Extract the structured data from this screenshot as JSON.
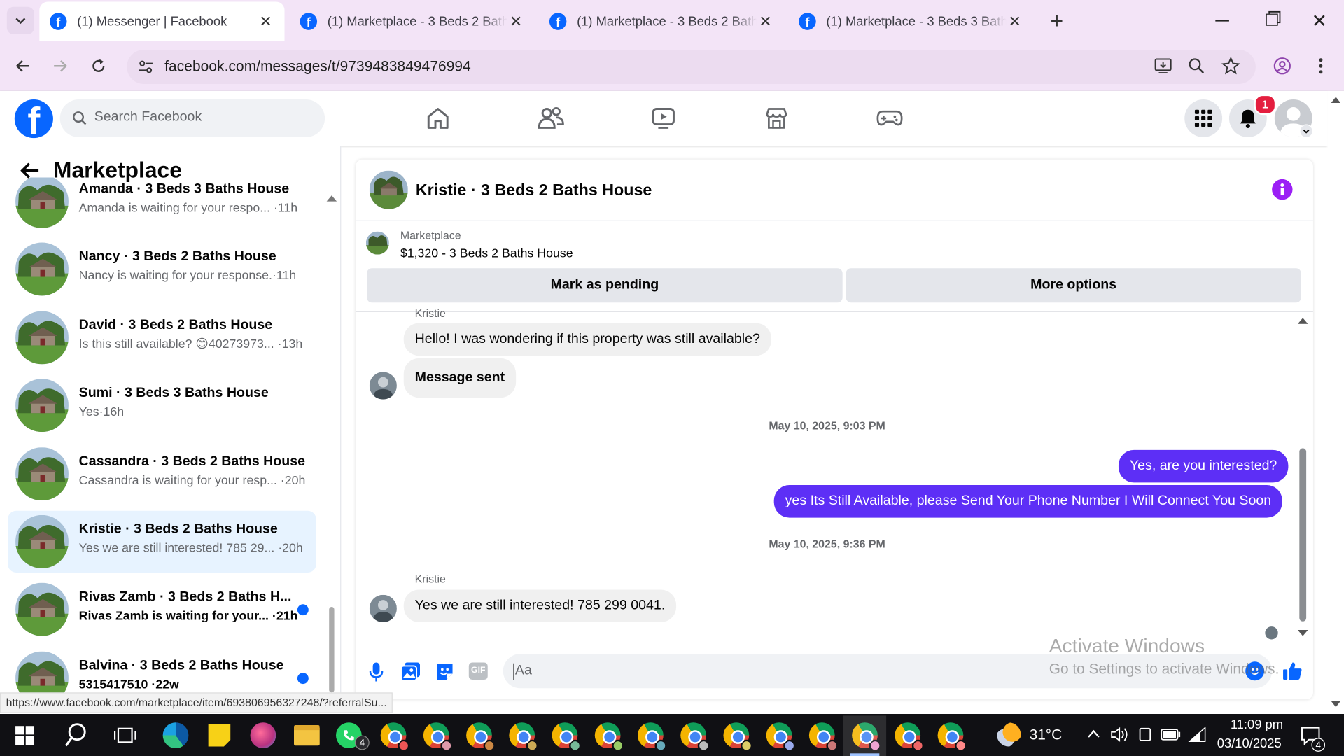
{
  "browser": {
    "tabs": [
      {
        "title": "(1) Messenger | Facebook",
        "active": true
      },
      {
        "title": "(1) Marketplace - 3 Beds 2 Bath",
        "active": false
      },
      {
        "title": "(1) Marketplace - 3 Beds 2 Bath",
        "active": false
      },
      {
        "title": "(1) Marketplace - 3 Beds 3 Bath",
        "active": false
      }
    ],
    "url": "facebook.com/messages/t/9739483849476994",
    "status_url": "https://www.facebook.com/marketplace/item/693806956327248/?referralSu..."
  },
  "fb_header": {
    "search_placeholder": "Search Facebook",
    "notification_count": "1",
    "logo_glyph": "f"
  },
  "left_panel": {
    "title": "Marketplace",
    "conversations": [
      {
        "name": "Amanda · 3 Beds 3 Baths House",
        "preview": "Amanda is waiting for your respo... ·11h",
        "unread": false,
        "selected": false
      },
      {
        "name": "Nancy · 3 Beds 2 Baths House",
        "preview": "Nancy is waiting for your response.·11h",
        "unread": false,
        "selected": false
      },
      {
        "name": "David · 3 Beds 2 Baths House",
        "preview": "Is this still available? 😊40273973... ·13h",
        "unread": false,
        "selected": false
      },
      {
        "name": "Sumi · 3 Beds 3 Baths House",
        "preview": "Yes·16h",
        "unread": false,
        "selected": false
      },
      {
        "name": "Cassandra · 3 Beds 2 Baths House",
        "preview": "Cassandra is waiting for your resp... ·20h",
        "unread": false,
        "selected": false
      },
      {
        "name": "Kristie · 3 Beds 2 Baths House",
        "preview": "Yes we are still interested! 785 29... ·20h",
        "unread": false,
        "selected": true
      },
      {
        "name": "Rivas Zamb · 3 Beds 2 Baths H...",
        "preview": "Rivas Zamb is waiting for your... ·21h",
        "unread": true,
        "selected": false
      },
      {
        "name": "Balvina · 3 Beds 2 Baths House",
        "preview": "5315417510 ·22w",
        "unread": true,
        "selected": false
      }
    ]
  },
  "chat": {
    "title": "Kristie · 3 Beds 2 Baths House",
    "listing_label": "Marketplace",
    "listing_title": "$1,320 - 3 Beds 2 Baths House",
    "mark_pending": "Mark as pending",
    "more_options": "More options",
    "sender_top": "Kristie",
    "msg_in_1": "Hello! I was wondering if this property was still available?",
    "msg_in_2": "Message sent",
    "stamp_1": "May 10, 2025, 9:03 PM",
    "msg_out_1": "Yes, are you interested?",
    "msg_out_2": "yes Its Still Available, please Send Your Phone Number I Will Connect You Soon",
    "stamp_2": "May 10, 2025, 9:36 PM",
    "sender_bottom": "Kristie",
    "msg_in_3": "Yes we are still interested! 785 299 0041.",
    "composer_placeholder": "Aa"
  },
  "watermark": {
    "line1": "Activate Windows",
    "line2": "Go to Settings to activate Windows."
  },
  "taskbar": {
    "weather_temp": "31°C",
    "time": "11:09 pm",
    "date": "03/10/2025",
    "whatsapp_badge": "4",
    "notif_badge": "4"
  },
  "colors": {
    "facebook_blue": "#0866ff",
    "messenger_purple": "#5d2ff6",
    "tabstrip": "#f3e4f7",
    "selected_row": "#e7f3ff"
  }
}
